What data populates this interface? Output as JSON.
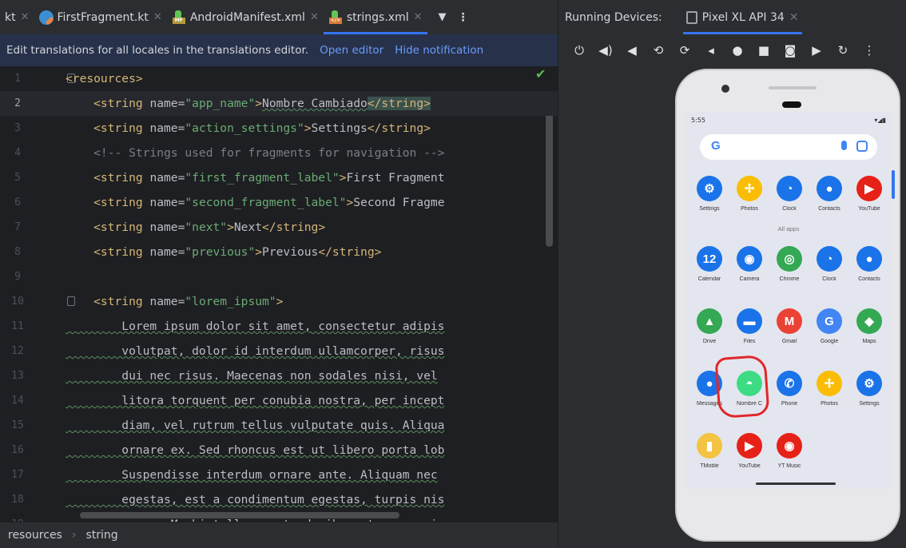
{
  "tabs": [
    {
      "label": "kt",
      "type": "partial"
    },
    {
      "label": "FirstFragment.kt",
      "type": "kotlin"
    },
    {
      "label": "AndroidManifest.xml",
      "type": "manifest",
      "badge": "MF"
    },
    {
      "label": "strings.xml",
      "type": "xml",
      "active": true
    }
  ],
  "notification": {
    "text": "Edit translations for all locales in the translations editor.",
    "open": "Open editor",
    "hide": "Hide notification"
  },
  "editor": {
    "lines": [
      {
        "n": "1",
        "parts": [
          {
            "c": "tg",
            "t": "<resources>"
          }
        ]
      },
      {
        "n": "2",
        "current": true,
        "parts": [
          {
            "c": "tg",
            "t": "    <string "
          },
          {
            "c": "at",
            "t": "name="
          },
          {
            "c": "vl",
            "t": "\"app_name\""
          },
          {
            "c": "tg",
            "t": ">"
          },
          {
            "c": "tx",
            "t": "Nombre Cambiado"
          },
          {
            "c": "tg",
            "t": "</string>"
          }
        ]
      },
      {
        "n": "3",
        "parts": [
          {
            "c": "tg",
            "t": "    <string "
          },
          {
            "c": "at",
            "t": "name="
          },
          {
            "c": "vl",
            "t": "\"action_settings\""
          },
          {
            "c": "tg",
            "t": ">"
          },
          {
            "c": "tx",
            "t": "Settings"
          },
          {
            "c": "tg",
            "t": "</string>"
          }
        ]
      },
      {
        "n": "4",
        "parts": [
          {
            "c": "cm",
            "t": "    <!-- Strings used for fragments for navigation -->"
          }
        ]
      },
      {
        "n": "5",
        "parts": [
          {
            "c": "tg",
            "t": "    <string "
          },
          {
            "c": "at",
            "t": "name="
          },
          {
            "c": "vl",
            "t": "\"first_fragment_label\""
          },
          {
            "c": "tg",
            "t": ">"
          },
          {
            "c": "tx",
            "t": "First Fragment"
          }
        ]
      },
      {
        "n": "6",
        "parts": [
          {
            "c": "tg",
            "t": "    <string "
          },
          {
            "c": "at",
            "t": "name="
          },
          {
            "c": "vl",
            "t": "\"second_fragment_label\""
          },
          {
            "c": "tg",
            "t": ">"
          },
          {
            "c": "tx",
            "t": "Second Fragme"
          }
        ]
      },
      {
        "n": "7",
        "parts": [
          {
            "c": "tg",
            "t": "    <string "
          },
          {
            "c": "at",
            "t": "name="
          },
          {
            "c": "vl",
            "t": "\"next\""
          },
          {
            "c": "tg",
            "t": ">"
          },
          {
            "c": "tx",
            "t": "Next"
          },
          {
            "c": "tg",
            "t": "</string>"
          }
        ]
      },
      {
        "n": "8",
        "parts": [
          {
            "c": "tg",
            "t": "    <string "
          },
          {
            "c": "at",
            "t": "name="
          },
          {
            "c": "vl",
            "t": "\"previous\""
          },
          {
            "c": "tg",
            "t": ">"
          },
          {
            "c": "tx",
            "t": "Previous"
          },
          {
            "c": "tg",
            "t": "</string>"
          }
        ]
      },
      {
        "n": "9",
        "parts": []
      },
      {
        "n": "10",
        "parts": [
          {
            "c": "tg",
            "t": "    <string "
          },
          {
            "c": "at",
            "t": "name="
          },
          {
            "c": "vl",
            "t": "\"lorem_ipsum\""
          },
          {
            "c": "tg",
            "t": ">"
          }
        ]
      },
      {
        "n": "11",
        "parts": [
          {
            "c": "tx",
            "t": "        Lorem ipsum dolor sit amet, consectetur adipis"
          }
        ]
      },
      {
        "n": "12",
        "parts": [
          {
            "c": "tx",
            "t": "        volutpat, dolor id interdum ullamcorper, risus"
          }
        ]
      },
      {
        "n": "13",
        "parts": [
          {
            "c": "tx",
            "t": "        dui nec risus. Maecenas non sodales nisi, vel"
          }
        ]
      },
      {
        "n": "14",
        "parts": [
          {
            "c": "tx",
            "t": "        litora torquent per conubia nostra, per incept"
          }
        ]
      },
      {
        "n": "15",
        "parts": [
          {
            "c": "tx",
            "t": "        diam, vel rutrum tellus vulputate quis. Aliqua"
          }
        ]
      },
      {
        "n": "16",
        "parts": [
          {
            "c": "tx",
            "t": "        ornare ex. Sed rhoncus est ut libero porta lob"
          }
        ]
      },
      {
        "n": "17",
        "parts": [
          {
            "c": "tx",
            "t": "        Suspendisse interdum ornare ante. Aliquam nec"
          }
        ]
      },
      {
        "n": "18",
        "parts": [
          {
            "c": "tx",
            "t": "        egestas, est a condimentum egestas, turpis nis"
          }
        ]
      },
      {
        "n": "19",
        "parts": [
          {
            "c": "tx",
            "t": "        neque. Morbi tellus erat, dapibus ut sem a, ia"
          }
        ]
      }
    ]
  },
  "breadcrumb": [
    "resources",
    "string"
  ],
  "devices": {
    "title": "Running Devices:",
    "device_tab": "Pixel XL API 34"
  },
  "phone": {
    "time": "5:55",
    "all_apps": "All apps",
    "apps": [
      {
        "label": "Settings",
        "color": "#1a73e8",
        "icon": "gear-icon"
      },
      {
        "label": "Photos",
        "color": "#fbbc04",
        "icon": "pinwheel-icon"
      },
      {
        "label": "Clock",
        "color": "#1a73e8",
        "icon": "clock-icon"
      },
      {
        "label": "Contacts",
        "color": "#1a73e8",
        "icon": "person-icon"
      },
      {
        "label": "YouTube",
        "color": "#e62117",
        "icon": "play-icon"
      },
      {
        "label": "Calendar",
        "color": "#1a73e8",
        "icon": "calendar-icon"
      },
      {
        "label": "Camera",
        "color": "#1a73e8",
        "icon": "camera-icon"
      },
      {
        "label": "Chrome",
        "color": "#34a853",
        "icon": "chrome-icon"
      },
      {
        "label": "Clock",
        "color": "#1a73e8",
        "icon": "clock-icon"
      },
      {
        "label": "Contacts",
        "color": "#1a73e8",
        "icon": "person-icon"
      },
      {
        "label": "Drive",
        "color": "#34a853",
        "icon": "drive-icon"
      },
      {
        "label": "Files",
        "color": "#1a73e8",
        "icon": "folder-icon"
      },
      {
        "label": "Gmail",
        "color": "#ea4335",
        "icon": "mail-icon"
      },
      {
        "label": "Google",
        "color": "#4285f4",
        "icon": "google-icon"
      },
      {
        "label": "Maps",
        "color": "#34a853",
        "icon": "map-pin-icon"
      },
      {
        "label": "Messages",
        "color": "#1a73e8",
        "icon": "chat-icon"
      },
      {
        "label": "Nombre C",
        "color": "#3ddc84",
        "icon": "android-icon"
      },
      {
        "label": "Phone",
        "color": "#1a73e8",
        "icon": "phone-icon"
      },
      {
        "label": "Photos",
        "color": "#fbbc04",
        "icon": "pinwheel-icon"
      },
      {
        "label": "Settings",
        "color": "#1a73e8",
        "icon": "gear-icon"
      },
      {
        "label": "TMoble",
        "color": "#f3c341",
        "icon": "tmobile-icon"
      },
      {
        "label": "YouTube",
        "color": "#e62117",
        "icon": "play-icon"
      },
      {
        "label": "YT Music",
        "color": "#e62117",
        "icon": "music-icon"
      }
    ]
  }
}
